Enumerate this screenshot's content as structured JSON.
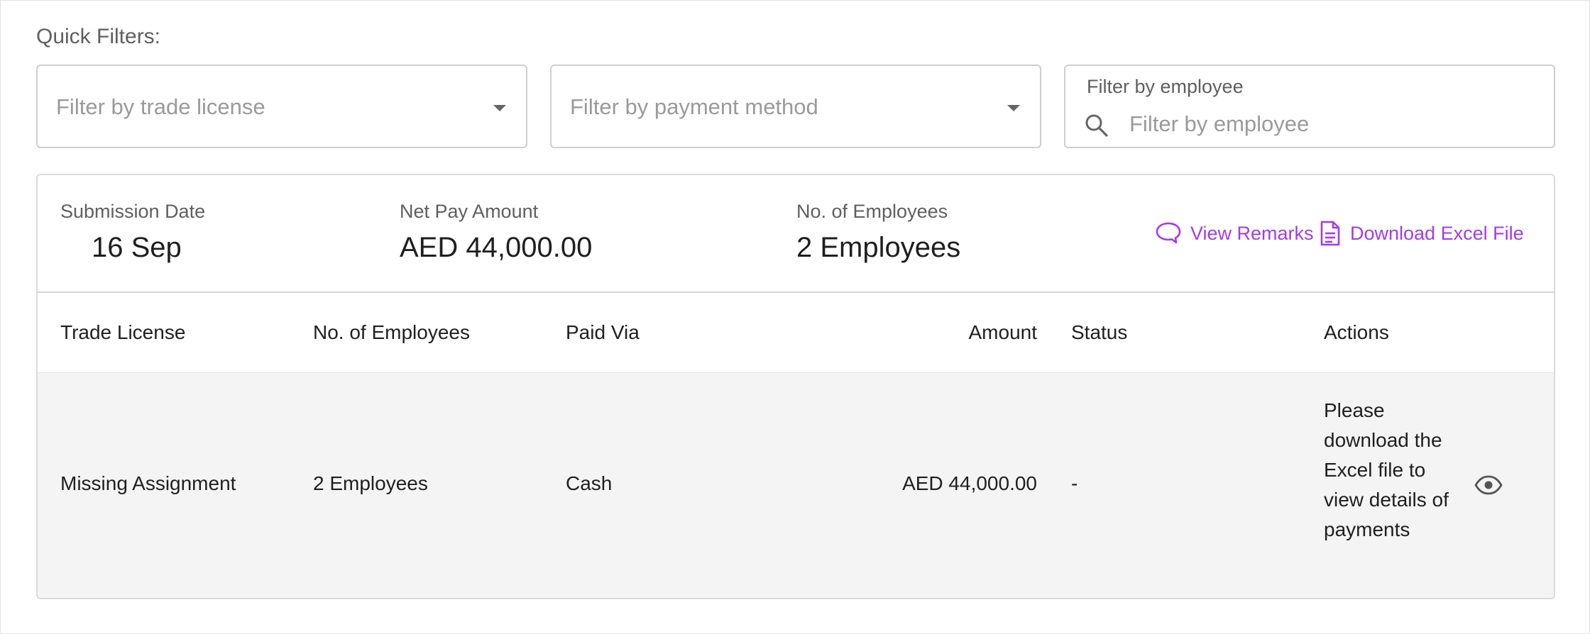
{
  "quick_filters": {
    "label": "Quick Filters:",
    "trade_license": {
      "placeholder": "Filter by trade license"
    },
    "payment_method": {
      "placeholder": "Filter by payment method"
    },
    "employee": {
      "label": "Filter by employee",
      "placeholder": "Filter by employee",
      "value": ""
    }
  },
  "summary": {
    "submission_date": {
      "label": "Submission Date",
      "value": "16 Sep"
    },
    "net_pay": {
      "label": "Net Pay Amount",
      "value": "AED 44,000.00"
    },
    "employees": {
      "label": "No. of Employees",
      "value": "2 Employees"
    },
    "view_remarks": "View Remarks",
    "download_excel": "Download Excel File"
  },
  "table": {
    "headers": [
      "Trade License",
      "No. of Employees",
      "Paid Via",
      "Amount",
      "Status",
      "Actions"
    ],
    "rows": [
      {
        "trade_license": "Missing Assignment",
        "employees": "2 Employees",
        "paid_via": "Cash",
        "amount": "AED 44,000.00",
        "status": "-",
        "actions_text": "Please download the Excel file to view details of payments"
      }
    ]
  },
  "colors": {
    "accent": "#a43be8",
    "row_bg": "#f4f4f4",
    "border": "#d6d6d6"
  },
  "icons": {
    "search": "search-icon",
    "dropdown": "chevron-down-icon",
    "remarks": "speech-bubble-icon",
    "download": "document-icon",
    "view": "eye-icon"
  }
}
